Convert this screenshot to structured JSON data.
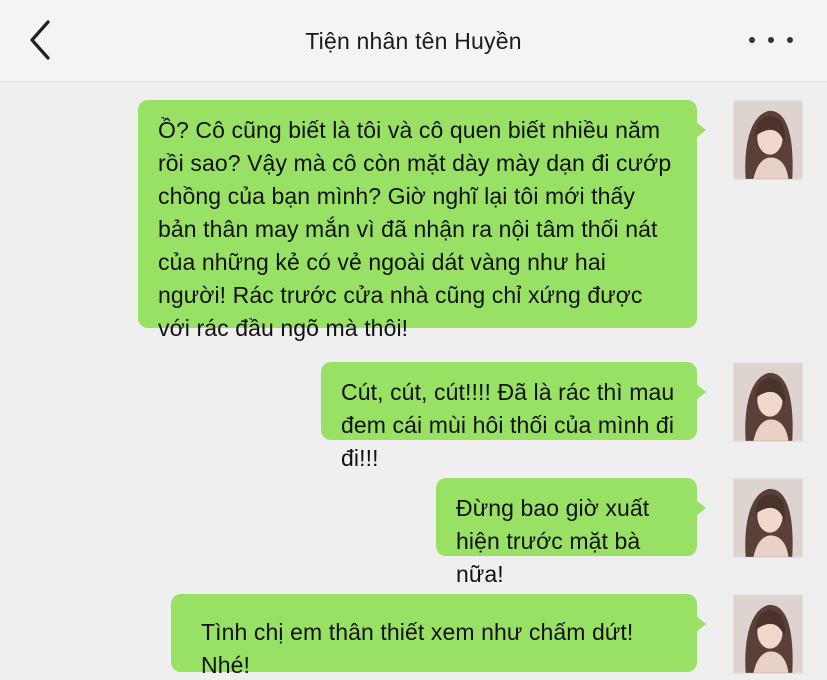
{
  "header": {
    "title": "Tiện nhân tên Huyền",
    "back_icon": "chevron-left-icon",
    "more_icon": "more-horizontal-icon"
  },
  "messages": [
    {
      "sender": "self",
      "text": "Ồ? Cô cũng biết là tôi và cô quen biết nhiều năm rồi sao? Vậy mà cô còn mặt dày mày dạn đi cướp chồng của bạn mình? Giờ nghĩ lại tôi mới thấy bản thân may mắn vì đã nhận ra nội tâm thối nát của những kẻ có vẻ ngoài dát vàng như hai người! Rác trước cửa nhà cũng chỉ xứng được với rác đầu ngõ mà thôi!"
    },
    {
      "sender": "self",
      "text": "Cút, cút, cút!!!! Đã là rác thì mau đem cái mùi hôi thối của mình đi đi!!!"
    },
    {
      "sender": "self",
      "text": "Đừng bao giờ xuất hiện trước mặt bà nữa!"
    },
    {
      "sender": "self",
      "text": "Tình chị em thân thiết xem như chấm dứt! Nhé!"
    }
  ],
  "colors": {
    "bubble_self": "#98e165",
    "background": "#efefef",
    "header": "#f4f4f4"
  }
}
